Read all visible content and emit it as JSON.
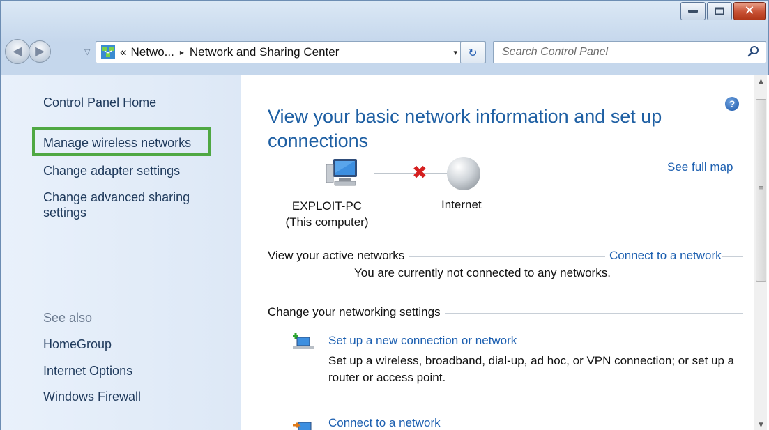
{
  "window": {
    "caption_buttons": [
      "minimize-icon",
      "maximize-icon",
      "close-icon"
    ],
    "close_color": "#c75033"
  },
  "navbar": {
    "breadcrumb": {
      "chevrons": "«",
      "parent": "Netwo...",
      "separator": "▸",
      "current": "Network and Sharing Center"
    },
    "dropdown_glyph": "▾",
    "refresh_glyph": "↻",
    "search_placeholder": "Search Control Panel"
  },
  "sidebar": {
    "home": "Control Panel Home",
    "links": [
      "Manage wireless networks",
      "Change adapter settings",
      "Change advanced sharing settings"
    ],
    "highlight_color": "#4fa843",
    "see_also_heading": "See also",
    "see_also": [
      "HomeGroup",
      "Internet Options",
      "Windows Firewall"
    ]
  },
  "main": {
    "title": "View your basic network information and set up connections",
    "see_full_map": "See full map",
    "computer_name": "EXPLOIT-PC",
    "computer_sub": "(This computer)",
    "internet_label": "Internet",
    "active_networks_label": "View your active networks",
    "connect_link": "Connect to a network",
    "not_connected": "You are currently not connected to any networks.",
    "change_settings_label": "Change your networking settings",
    "tasks": [
      {
        "title": "Set up a new connection or network",
        "desc": "Set up a wireless, broadband, dial-up, ad hoc, or VPN connection; or set up a router or access point."
      },
      {
        "title": "Connect to a network",
        "desc": ""
      }
    ],
    "help_glyph": "?"
  },
  "colors": {
    "link": "#1c5fb0",
    "title": "#1e5fa3",
    "sidebar_bg": "#e4edf9"
  }
}
